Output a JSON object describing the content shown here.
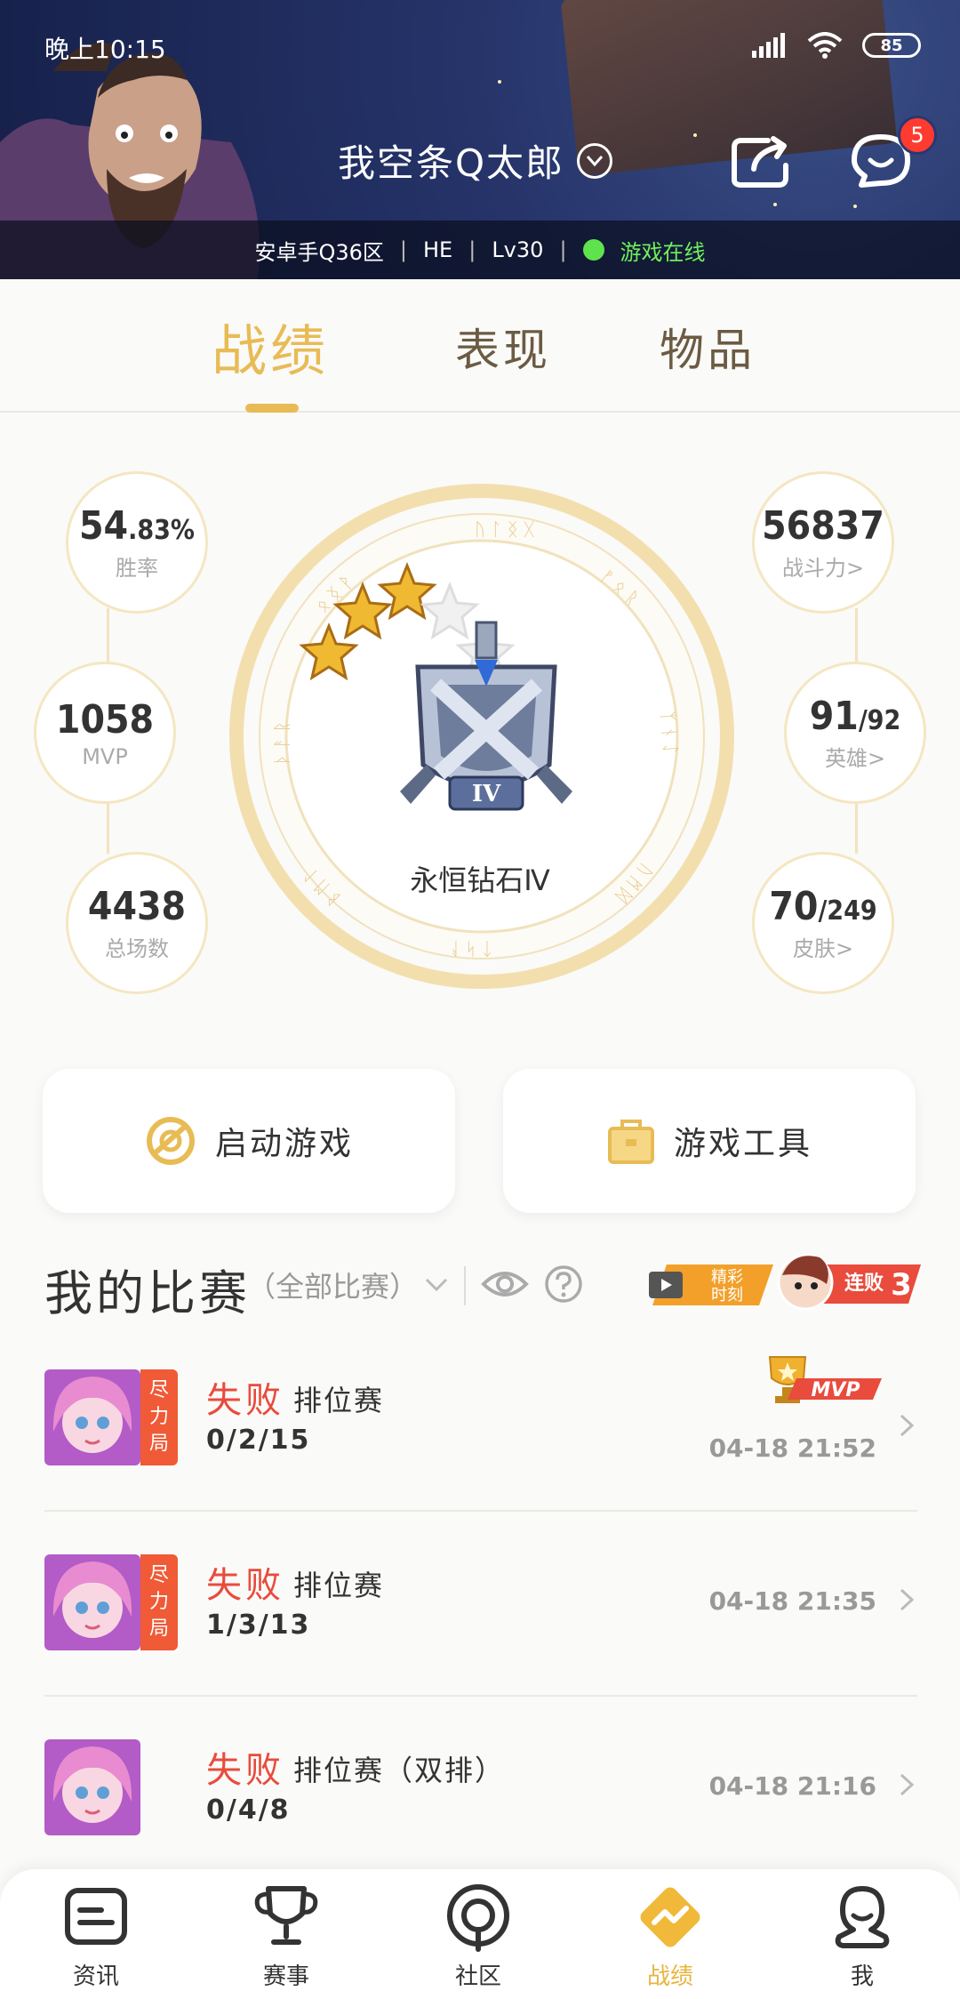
{
  "status_bar": {
    "time": "晚上10:15",
    "battery": "85"
  },
  "header": {
    "username": "我空条Q太郎",
    "server": "安卓手Q36区",
    "guild": "HE",
    "level": "Lv30",
    "online_status": "游戏在线",
    "message_badge": "5"
  },
  "tabs": [
    {
      "label": "战绩"
    },
    {
      "label": "表现"
    },
    {
      "label": "物品"
    }
  ],
  "stats": {
    "win_rate": {
      "value_main": "54",
      "value_sub": ".83%",
      "label": "胜率"
    },
    "mvp": {
      "value": "1058",
      "label": "MVP"
    },
    "total_games": {
      "value": "4438",
      "label": "总场数"
    },
    "power": {
      "value": "56837",
      "label": "战斗力",
      "label_arrow": ">"
    },
    "heroes": {
      "value_main": "91",
      "value_sub": "/92",
      "label": "英雄",
      "label_arrow": ">"
    },
    "skins": {
      "value_main": "70",
      "value_sub": "/249",
      "label": "皮肤",
      "label_arrow": ">"
    }
  },
  "rank": {
    "name": "永恒钻石Ⅳ",
    "tier_numeral": "IV",
    "stars_filled": 3,
    "stars_total": 5
  },
  "actions": {
    "launch_game": "启动游戏",
    "game_tools": "游戏工具"
  },
  "matches_section": {
    "title": "我的比赛",
    "filter": "（全部比赛）",
    "highlight_label_1": "精彩",
    "highlight_label_2": "时刻",
    "streak_label": "连败",
    "streak_count": "3"
  },
  "matches": [
    {
      "tag": [
        "尽",
        "力",
        "局"
      ],
      "result": "失败",
      "mode": "排位赛",
      "kda": "0/2/15",
      "time": "04-18 21:52",
      "mvp": "MVP"
    },
    {
      "tag": [
        "尽",
        "力",
        "局"
      ],
      "result": "失败",
      "mode": "排位赛",
      "kda": "1/3/13",
      "time": "04-18 21:35"
    },
    {
      "result": "失败",
      "mode": "排位赛（双排）",
      "kda": "0/4/8",
      "time": "04-18 21:16"
    }
  ],
  "bottom_nav": [
    {
      "label": "资讯"
    },
    {
      "label": "赛事"
    },
    {
      "label": "社区"
    },
    {
      "label": "战绩"
    },
    {
      "label": "我"
    }
  ],
  "colors": {
    "accent": "#e8bb55",
    "loss": "#e94b3c",
    "online": "#5ee34d",
    "badge": "#ff3b30"
  }
}
